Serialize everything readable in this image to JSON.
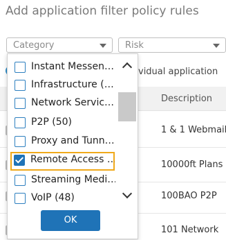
{
  "title": "Add application filter policy rules",
  "filters": {
    "category_placeholder": "Category",
    "risk_placeholder": "Risk"
  },
  "background": {
    "individual_text": "vidual application",
    "description_header": "Description",
    "rows": [
      "1 & 1 Webmail",
      "10000ft Plans",
      "100BAO P2P",
      "101 Network"
    ]
  },
  "dropdown": {
    "options": [
      {
        "label": "Instant Messen…",
        "checked": false
      },
      {
        "label": "Infrastructure (…",
        "checked": false
      },
      {
        "label": "Network Servic…",
        "checked": false
      },
      {
        "label": "P2P (50)",
        "checked": false
      },
      {
        "label": "Proxy and Tunn…",
        "checked": false
      },
      {
        "label": "Remote Access …",
        "checked": true
      },
      {
        "label": "Streaming Medi…",
        "checked": false
      },
      {
        "label": "VoIP (48)",
        "checked": false
      }
    ],
    "ok_label": "OK"
  },
  "colors": {
    "accent": "#1f73b7",
    "focus_outline": "#f0a91a"
  }
}
